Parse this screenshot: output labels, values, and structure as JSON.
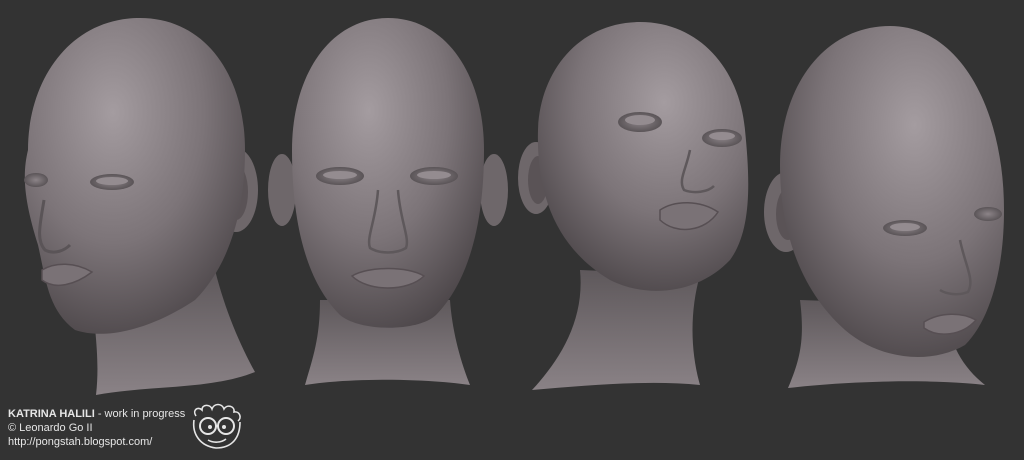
{
  "caption": {
    "name": "KATRINA HALILI",
    "subtitle": " - work in progress",
    "copyright": "© Leonardo Go II",
    "url": "http://pongstah.blogspot.com/"
  },
  "colors": {
    "background": "#333333",
    "clay_light": "#9a9296",
    "clay_mid": "#7a7276",
    "clay_dark": "#4a4447",
    "caption_text": "#e6e6e6"
  },
  "views": [
    "three-quarter-left",
    "front",
    "upward-three-quarter-right",
    "three-quarter-right"
  ],
  "logo": "cartoon-face-with-glasses-icon"
}
